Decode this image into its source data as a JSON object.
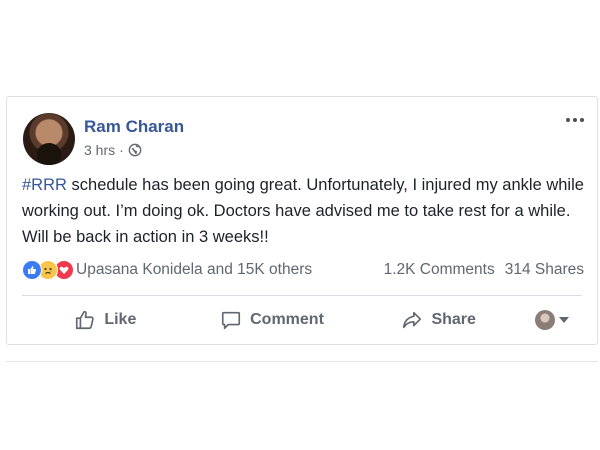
{
  "post": {
    "author": "Ram Charan",
    "time": "3 hrs",
    "separator": "·",
    "hashtag": "#RRR",
    "body": " schedule has been going great. Unfortunately, I injured my ankle while working out. I’m doing ok. Doctors have advised me to take rest for a while. Will be back in action in 3 weeks!!"
  },
  "reactions": {
    "icons": [
      "like-icon",
      "sad-icon",
      "love-icon"
    ],
    "summary": "Upasana Konidela and 15K others",
    "comments": "1.2K Comments",
    "shares": "314 Shares"
  },
  "actions": {
    "like": "Like",
    "comment": "Comment",
    "share": "Share"
  },
  "colors": {
    "link": "#365899",
    "secondary_text": "#616770",
    "like_blue": "#3b7cf5",
    "love_red": "#f0394f",
    "sad_yellow": "#f7c64a"
  }
}
